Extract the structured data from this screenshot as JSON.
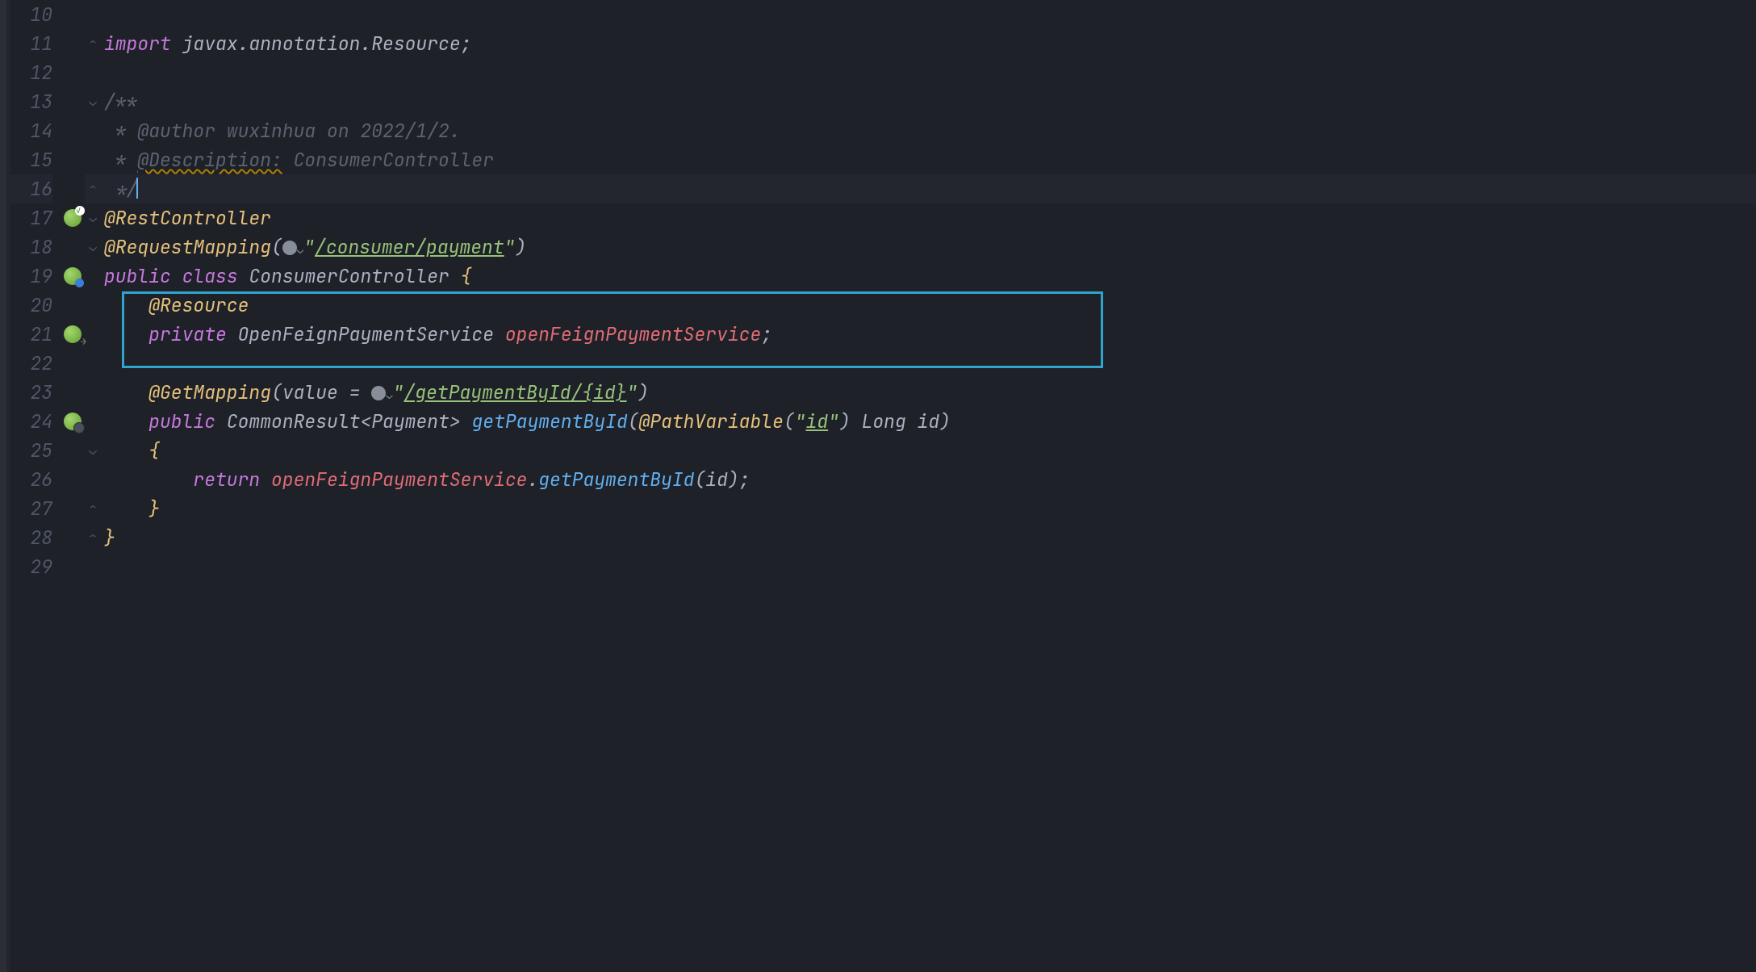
{
  "gutter": {
    "start": 10,
    "end": 29
  },
  "code": {
    "import_kw": "import",
    "import_pkg": "javax.annotation.",
    "import_cls": "Resource",
    "doc_open": "/**",
    "doc_author_tag": "@author",
    "doc_author_val": "wuxinhua on 2022/1/2.",
    "doc_desc_tag": "@Description:",
    "doc_desc_val": "ConsumerController",
    "doc_close": " */",
    "anno_rest": "@RestController",
    "anno_reqmap": "@RequestMapping",
    "reqmap_path": "/consumer/payment",
    "kw_public": "public",
    "kw_class": "class",
    "class_name": "ConsumerController",
    "anno_resource": "@Resource",
    "kw_private": "private",
    "field_type": "OpenFeignPaymentService",
    "field_name": "openFeignPaymentService",
    "anno_getmap": "@GetMapping",
    "getmap_param": "value",
    "getmap_path": "/getPaymentById/{id}",
    "ret_type1": "CommonResult",
    "ret_type2": "Payment",
    "method_name": "getPaymentById",
    "param_anno": "@PathVariable",
    "param_anno_val": "id",
    "param_type": "Long",
    "param_name": "id",
    "kw_return": "return",
    "call_obj": "openFeignPaymentService",
    "call_method": "getPaymentById",
    "call_arg": "id"
  }
}
